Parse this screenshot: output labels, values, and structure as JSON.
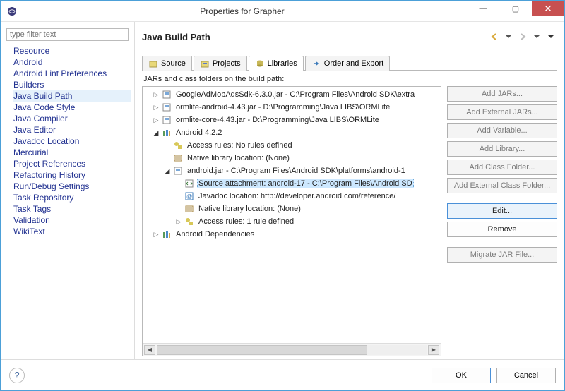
{
  "window": {
    "title": "Properties for Grapher"
  },
  "sidebar": {
    "filter_placeholder": "type filter text",
    "items": [
      {
        "label": "Resource"
      },
      {
        "label": "Android"
      },
      {
        "label": "Android Lint Preferences"
      },
      {
        "label": "Builders"
      },
      {
        "label": "Java Build Path",
        "selected": true
      },
      {
        "label": "Java Code Style"
      },
      {
        "label": "Java Compiler"
      },
      {
        "label": "Java Editor"
      },
      {
        "label": "Javadoc Location"
      },
      {
        "label": "Mercurial"
      },
      {
        "label": "Project References"
      },
      {
        "label": "Refactoring History"
      },
      {
        "label": "Run/Debug Settings"
      },
      {
        "label": "Task Repository"
      },
      {
        "label": "Task Tags"
      },
      {
        "label": "Validation"
      },
      {
        "label": "WikiText"
      }
    ]
  },
  "main": {
    "title": "Java Build Path",
    "tabs": [
      {
        "label": "Source"
      },
      {
        "label": "Projects"
      },
      {
        "label": "Libraries",
        "active": true
      },
      {
        "label": "Order and Export"
      }
    ],
    "description": "JARs and class folders on the build path:"
  },
  "tree": {
    "n0": "GoogleAdMobAdsSdk-6.3.0.jar - C:\\Program Files\\Android SDK\\extra",
    "n1": "ormlite-android-4.43.jar - D:\\Programming\\Java LIBS\\ORMLite",
    "n2": "ormlite-core-4.43.jar - D:\\Programming\\Java LIBS\\ORMLite",
    "n3": "Android 4.2.2",
    "n4": "Access rules: No rules defined",
    "n5": "Native library location: (None)",
    "n6": "android.jar - C:\\Program Files\\Android SDK\\platforms\\android-1",
    "n7": "Source attachment: android-17 - C:\\Program Files\\Android SD",
    "n8": "Javadoc location: http://developer.android.com/reference/",
    "n9": "Native library location: (None)",
    "n10": "Access rules: 1 rule defined",
    "n11": "Android Dependencies"
  },
  "buttons": {
    "add_jars": "Add JARs...",
    "add_external_jars": "Add External JARs...",
    "add_variable": "Add Variable...",
    "add_library": "Add Library...",
    "add_class_folder": "Add Class Folder...",
    "add_external_class_folder": "Add External Class Folder...",
    "edit": "Edit...",
    "remove": "Remove",
    "migrate": "Migrate JAR File..."
  },
  "footer": {
    "ok": "OK",
    "cancel": "Cancel"
  }
}
